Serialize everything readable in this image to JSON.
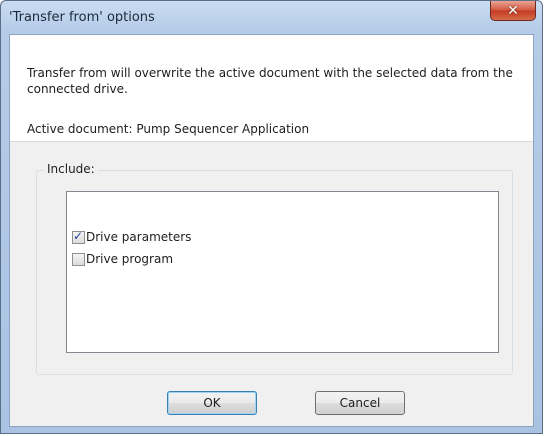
{
  "window": {
    "title": "'Transfer from' options",
    "close_glyph": "✕"
  },
  "message": {
    "description": "Transfer from will overwrite the active document with the selected data from the connected drive.",
    "active_document": "Active document: Pump Sequencer Application"
  },
  "include": {
    "label": "Include:",
    "items": [
      {
        "label": "Drive parameters",
        "checked": true
      },
      {
        "label": "Drive program",
        "checked": false
      }
    ]
  },
  "buttons": {
    "ok": "OK",
    "cancel": "Cancel"
  },
  "colors": {
    "titlebar": "#b9d1ea",
    "close": "#c7432b",
    "client": "#f0f0f0"
  }
}
